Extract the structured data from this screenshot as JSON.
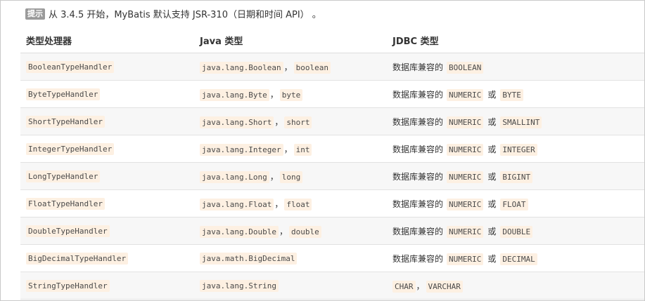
{
  "tip": {
    "badge": "提示",
    "text": "从 3.4.5 开始，MyBatis 默认支持 JSR-310（日期和时间 API） 。"
  },
  "table": {
    "headers": [
      "类型处理器",
      "Java 类型",
      "JDBC 类型"
    ],
    "rows": [
      {
        "handler": "BooleanTypeHandler",
        "java1": "java.lang.Boolean",
        "sep": "，",
        "java2": "boolean",
        "jdbc_prefix": "数据库兼容的",
        "jdbc1": "BOOLEAN",
        "jdbc_or": "",
        "jdbc2": ""
      },
      {
        "handler": "ByteTypeHandler",
        "java1": "java.lang.Byte",
        "sep": "，",
        "java2": "byte",
        "jdbc_prefix": "数据库兼容的",
        "jdbc1": "NUMERIC",
        "jdbc_or": "或",
        "jdbc2": "BYTE"
      },
      {
        "handler": "ShortTypeHandler",
        "java1": "java.lang.Short",
        "sep": "，",
        "java2": "short",
        "jdbc_prefix": "数据库兼容的",
        "jdbc1": "NUMERIC",
        "jdbc_or": "或",
        "jdbc2": "SMALLINT"
      },
      {
        "handler": "IntegerTypeHandler",
        "java1": "java.lang.Integer",
        "sep": "，",
        "java2": "int",
        "jdbc_prefix": "数据库兼容的",
        "jdbc1": "NUMERIC",
        "jdbc_or": "或",
        "jdbc2": "INTEGER"
      },
      {
        "handler": "LongTypeHandler",
        "java1": "java.lang.Long",
        "sep": "，",
        "java2": "long",
        "jdbc_prefix": "数据库兼容的",
        "jdbc1": "NUMERIC",
        "jdbc_or": "或",
        "jdbc2": "BIGINT"
      },
      {
        "handler": "FloatTypeHandler",
        "java1": "java.lang.Float",
        "sep": "，",
        "java2": "float",
        "jdbc_prefix": "数据库兼容的",
        "jdbc1": "NUMERIC",
        "jdbc_or": "或",
        "jdbc2": "FLOAT"
      },
      {
        "handler": "DoubleTypeHandler",
        "java1": "java.lang.Double",
        "sep": "，",
        "java2": "double",
        "jdbc_prefix": "数据库兼容的",
        "jdbc1": "NUMERIC",
        "jdbc_or": "或",
        "jdbc2": "DOUBLE"
      },
      {
        "handler": "BigDecimalTypeHandler",
        "java1": "java.math.BigDecimal",
        "sep": "",
        "java2": "",
        "jdbc_prefix": "数据库兼容的",
        "jdbc1": "NUMERIC",
        "jdbc_or": "或",
        "jdbc2": "DECIMAL"
      },
      {
        "handler": "StringTypeHandler",
        "java1": "java.lang.String",
        "sep": "",
        "java2": "",
        "jdbc_prefix": "",
        "jdbc1": "CHAR",
        "jdbc_or": "，",
        "jdbc2": "VARCHAR"
      }
    ]
  }
}
